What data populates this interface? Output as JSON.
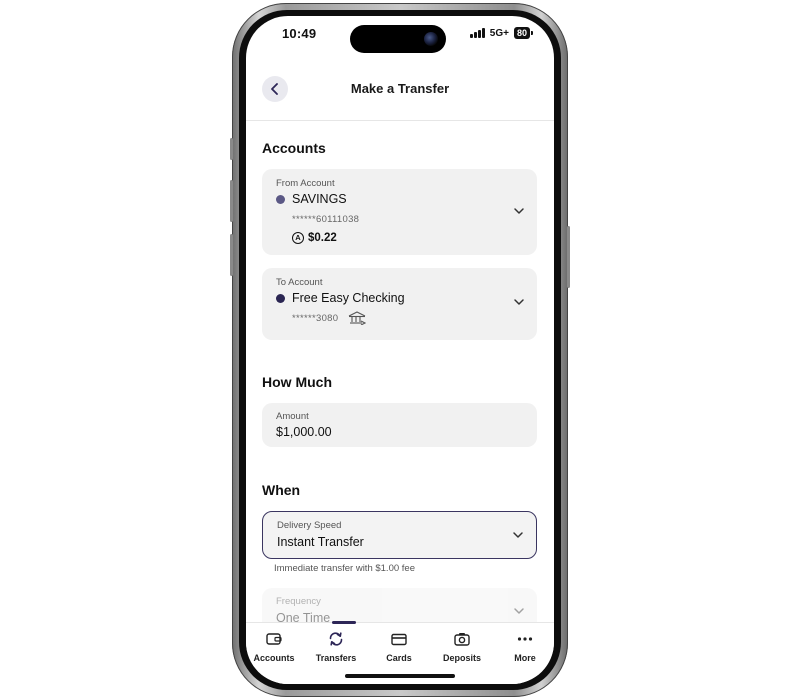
{
  "status_bar": {
    "time": "10:49",
    "network": "5G+",
    "battery": "80"
  },
  "header": {
    "title": "Make a Transfer",
    "back_icon": "chevron-left-icon"
  },
  "accounts_section": {
    "title": "Accounts",
    "from": {
      "label": "From Account",
      "name": "SAVINGS",
      "number": "******60111038",
      "balance": "$0.22",
      "balance_icon": "available-balance-icon",
      "dot_color": "#5b5885"
    },
    "to": {
      "label": "To Account",
      "name": "Free Easy Checking",
      "number": "******3080",
      "bank_icon": "bank-icon",
      "dot_color": "#2a2552"
    }
  },
  "amount_section": {
    "title": "How Much",
    "label": "Amount",
    "value": "$1,000.00"
  },
  "when_section": {
    "title": "When",
    "delivery_label": "Delivery Speed",
    "delivery_value": "Instant Transfer",
    "delivery_helper": "Immediate transfer with $1.00 fee",
    "frequency_label": "Frequency",
    "frequency_value": "One Time"
  },
  "bottom_nav": {
    "active": "Transfers",
    "accent_color": "#2d2657",
    "items": [
      {
        "label": "Accounts",
        "icon": "wallet-icon"
      },
      {
        "label": "Transfers",
        "icon": "transfer-arrows-icon"
      },
      {
        "label": "Cards",
        "icon": "card-icon"
      },
      {
        "label": "Deposits",
        "icon": "camera-icon"
      },
      {
        "label": "More",
        "icon": "more-dots-icon"
      }
    ]
  }
}
